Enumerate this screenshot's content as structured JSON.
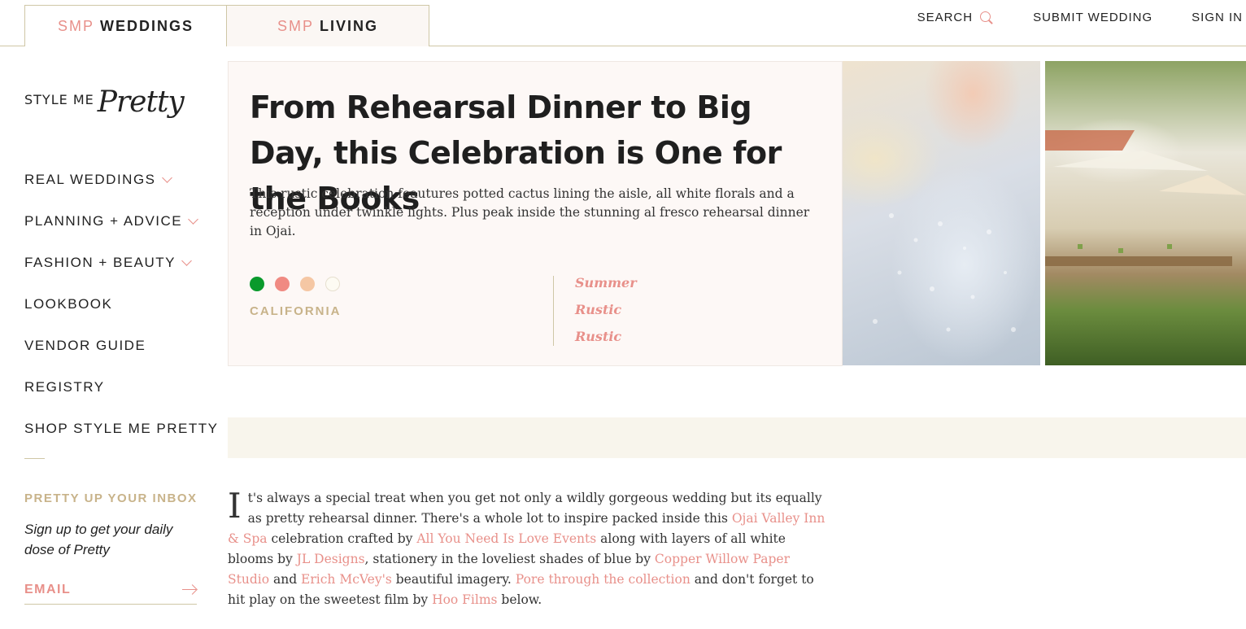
{
  "topbar": {
    "tabs": [
      {
        "prefix": "SMP",
        "name": "WEDDINGS"
      },
      {
        "prefix": "SMP",
        "name": "LIVING"
      }
    ],
    "search_label": "SEARCH",
    "search_icon": "search-icon",
    "submit_label": "SUBMIT WEDDING",
    "signin_label": "SIGN IN"
  },
  "sidebar": {
    "logo": {
      "style_me": "STYLE ME",
      "pretty": "Pretty"
    },
    "nav": [
      {
        "label": "REAL WEDDINGS",
        "has_dropdown": true
      },
      {
        "label": "PLANNING + ADVICE",
        "has_dropdown": true
      },
      {
        "label": "FASHION + BEAUTY",
        "has_dropdown": true
      },
      {
        "label": "LOOKBOOK",
        "has_dropdown": false
      },
      {
        "label": "VENDOR GUIDE",
        "has_dropdown": false
      },
      {
        "label": "REGISTRY",
        "has_dropdown": false
      },
      {
        "label": "SHOP STYLE ME PRETTY",
        "has_dropdown": false
      }
    ],
    "inbox_title": "PRETTY UP YOUR INBOX",
    "inbox_subtitle": "Sign up to get your daily dose of Pretty",
    "email_placeholder": "EMAIL"
  },
  "hero": {
    "title": "From Rehearsal Dinner to Big Day, this Celebration is One for the Books",
    "description": "This rustic celebration feautures potted cactus lining the aisle, all white florals and a reception under twinkle lights. Plus peak inside the stunning al fresco rehearsal dinner in Ojai.",
    "swatches": [
      "#0a9a2c",
      "#f08a82",
      "#f5c7a4",
      "#fdfbf3"
    ],
    "location": "CALIFORNIA",
    "tags": [
      "Summer",
      "Rustic",
      "Rustic"
    ]
  },
  "article": {
    "dropcap": "I",
    "parts": [
      {
        "text": "t's always a special treat when you get not only a wildly gorgeous wedding but its equally as pretty rehearsal dinner. There's a whole lot to inspire packed inside this ",
        "link": false
      },
      {
        "text": "Ojai Valley Inn & Spa",
        "link": true
      },
      {
        "text": " celebration crafted by ",
        "link": false
      },
      {
        "text": "All You Need Is Love Events",
        "link": true
      },
      {
        "text": " along with layers of all white blooms by ",
        "link": false
      },
      {
        "text": "JL Designs",
        "link": true
      },
      {
        "text": ", stationery in the loveliest shades of blue by ",
        "link": false
      },
      {
        "text": "Copper Willow Paper Studio",
        "link": true
      },
      {
        "text": " and ",
        "link": false
      },
      {
        "text": "Erich McVey's",
        "link": true
      },
      {
        "text": " beautiful imagery. ",
        "link": false
      },
      {
        "text": "Pore through the collection",
        "link": true
      },
      {
        "text": " and don't forget to hit play on the sweetest film by ",
        "link": false
      },
      {
        "text": "Hoo Films",
        "link": true
      },
      {
        "text": " below.",
        "link": false
      }
    ]
  },
  "colors": {
    "accent": "#e8908a",
    "gold": "#c8b38a",
    "border": "#cfc7a6"
  }
}
